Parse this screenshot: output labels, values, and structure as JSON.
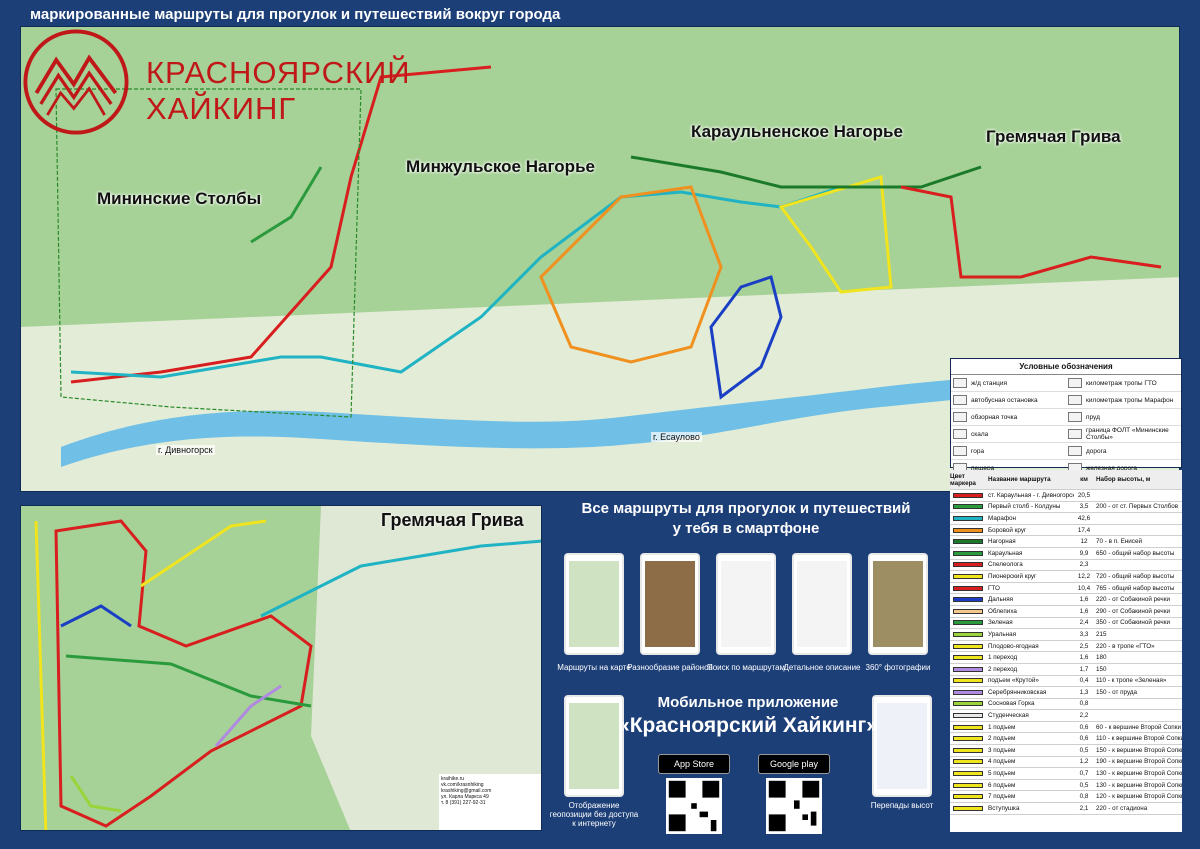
{
  "header": {
    "caption": "маркированные маршруты для прогулок и путешествий вокруг города"
  },
  "brand": {
    "line1": "КРАСНОЯРСКИЙ",
    "line2": "ХАЙКИНГ",
    "color": "#c01818"
  },
  "regions": [
    {
      "label": "Мининские Столбы"
    },
    {
      "label": "Минжульское Нагорье"
    },
    {
      "label": "Караульненское Нагорье"
    },
    {
      "label": "Гремячая Грива"
    }
  ],
  "cities": {
    "divnogorsk": "г. Дивногорск",
    "esaulovo": "г. Есаулово"
  },
  "legend": {
    "title": "Условные обозначения",
    "items": [
      {
        "label": "ж/д станция"
      },
      {
        "label": "километраж тропы ГТО"
      },
      {
        "label": "автобусная остановка"
      },
      {
        "label": "километраж тропы Марафон"
      },
      {
        "label": "обзорная точка"
      },
      {
        "label": "пруд"
      },
      {
        "label": "скала"
      },
      {
        "label": "граница ФОЛТ «Мининские Столбы»"
      },
      {
        "label": "гора"
      },
      {
        "label": "дорога"
      },
      {
        "label": "пещера"
      },
      {
        "label": "железная дорога"
      }
    ]
  },
  "inset": {
    "title": "Гремячая Грива"
  },
  "contacts": {
    "lines": [
      "kraihike.ru",
      "vk.com/krasnhiking",
      "krashiking@gmail.com",
      "ул. Карла Маркса 49",
      "т. 8 (391) 227-92-31"
    ]
  },
  "promo": {
    "title_line1": "Все маршруты для прогулок и путешествий",
    "title_line2": "у тебя в смартфоне",
    "features": [
      {
        "label": "Маршруты на карте"
      },
      {
        "label": "Разнообразие районов"
      },
      {
        "label": "Поиск по маршрутам"
      },
      {
        "label": "Детальное описание"
      },
      {
        "label": "360° фотографии"
      },
      {
        "label": "Отображение геопозиции без доступа к интернету"
      },
      {
        "label": "Перепады высот"
      }
    ],
    "app_title": "Мобильное приложение",
    "app_name": "«Красноярский Хайкинг»",
    "appstore": "App Store",
    "googleplay": "Google play"
  },
  "routes_table": {
    "headers": {
      "color": "Цвет маркера",
      "name": "Название маршрута",
      "km": "км",
      "elev": "Набор высоты, м"
    },
    "rows": [
      {
        "color": "#d81e1e",
        "name": "ст. Караульная - г. Дивногорск",
        "km": "20,5",
        "elev": ""
      },
      {
        "color": "#2a9a3c",
        "name": "Первый столб - Колдуны",
        "km": "3,5",
        "elev": "200 - от ст. Первых Столбов"
      },
      {
        "color": "#1fb3c4",
        "name": "Марафон",
        "km": "42,6",
        "elev": ""
      },
      {
        "color": "#f0901e",
        "name": "Боровой круг",
        "km": "17,4",
        "elev": ""
      },
      {
        "color": "#1b7a2a",
        "name": "Нагорная",
        "km": "12",
        "elev": "70 - в п. Енисей"
      },
      {
        "color": "#2a9a3c",
        "name": "Караульная",
        "km": "9,9",
        "elev": "650 - общий набор высоты"
      },
      {
        "color": "#d81e1e",
        "name": "Спелеолога",
        "km": "2,3",
        "elev": ""
      },
      {
        "color": "#f0e41e",
        "name": "Пионерский круг",
        "km": "12,2",
        "elev": "720 - общий набор высоты"
      },
      {
        "color": "#d81e1e",
        "name": "ГТО",
        "km": "10,4",
        "elev": "765 - общий набор высоты"
      },
      {
        "color": "#1a3fc4",
        "name": "Дальняя",
        "km": "1,6",
        "elev": "220 - от Собакиной речки"
      },
      {
        "color": "#f3c88a",
        "name": "Облепиха",
        "km": "1,6",
        "elev": "290 - от Собакиной речки"
      },
      {
        "color": "#2a9a3c",
        "name": "Зеленая",
        "km": "2,4",
        "elev": "350 - от Собакиной речки"
      },
      {
        "color": "#9ad43a",
        "name": "Уральная",
        "km": "3,3",
        "elev": "215"
      },
      {
        "color": "#f0e41e",
        "name": "Плодово-ягодная",
        "km": "2,5",
        "elev": "220 - в тропе «ГТО»"
      },
      {
        "color": "#f0e41e",
        "name": "1 переход",
        "km": "1,6",
        "elev": "180"
      },
      {
        "color": "#b089e0",
        "name": "2 переход",
        "km": "1,7",
        "elev": "150"
      },
      {
        "color": "#f0e41e",
        "name": "подъем «Крутой»",
        "km": "0,4",
        "elev": "110 - к тропе «Зеленая»"
      },
      {
        "color": "#b089e0",
        "name": "Серебрянниковская",
        "km": "1,3",
        "elev": "150 - от пруда"
      },
      {
        "color": "#9ad43a",
        "name": "Сосновая Горка",
        "km": "0,8",
        "elev": ""
      },
      {
        "color": "#e8e8e8",
        "name": "Студенческая",
        "km": "2,2",
        "elev": ""
      },
      {
        "color": "#f0e41e",
        "name": "1 подъем",
        "km": "0,6",
        "elev": "60 - к вершине Второй Сопки"
      },
      {
        "color": "#f0e41e",
        "name": "2 подъем",
        "km": "0,6",
        "elev": "110 - к вершине Второй Сопки"
      },
      {
        "color": "#f0e41e",
        "name": "3 подъем",
        "km": "0,5",
        "elev": "150 - к вершине Второй Сопки"
      },
      {
        "color": "#f0e41e",
        "name": "4 подъем",
        "km": "1,2",
        "elev": "190 - к вершине Второй Сопки"
      },
      {
        "color": "#f0e41e",
        "name": "5 подъем",
        "km": "0,7",
        "elev": "130 - к вершине Второй Сопки"
      },
      {
        "color": "#f0e41e",
        "name": "6 подъем",
        "km": "0,5",
        "elev": "130 - к вершине Второй Сопки"
      },
      {
        "color": "#f0e41e",
        "name": "7 подъем",
        "km": "0,8",
        "elev": "120 - к вершине Второй Сопки"
      },
      {
        "color": "#f0e41e",
        "name": "Вступушка",
        "km": "2,1",
        "elev": "220 - от стадиона"
      }
    ]
  }
}
